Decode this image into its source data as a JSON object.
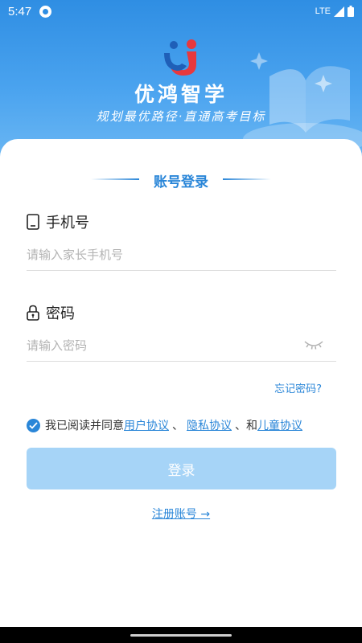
{
  "status_bar": {
    "time": "5:47",
    "network": "LTE"
  },
  "brand": {
    "name": "优鸿智学",
    "slogan": "规划最优路径·直通高考目标"
  },
  "login": {
    "section_title": "账号登录",
    "phone": {
      "label": "手机号",
      "placeholder": "请输入家长手机号",
      "value": ""
    },
    "password": {
      "label": "密码",
      "placeholder": "请输入密码",
      "value": ""
    },
    "forgot_password": "忘记密码?",
    "agreement": {
      "checked": true,
      "prefix": "我已阅读并同意",
      "user_agreement": "用户协议",
      "sep1": "、",
      "privacy_agreement": "隐私协议",
      "sep2": "、和",
      "child_agreement": "儿童协议"
    },
    "submit_label": "登录",
    "register_label": "注册账号 →"
  },
  "colors": {
    "primary": "#2a86d8",
    "header_gradient_top": "#2f8ee3",
    "button_disabled": "#a6d4f7",
    "logo_red": "#e8383d"
  },
  "icons": {
    "phone_field": "phone-icon",
    "password_field": "lock-icon",
    "password_visibility": "eye-closed-icon",
    "agreement_check": "check-circle-icon"
  }
}
